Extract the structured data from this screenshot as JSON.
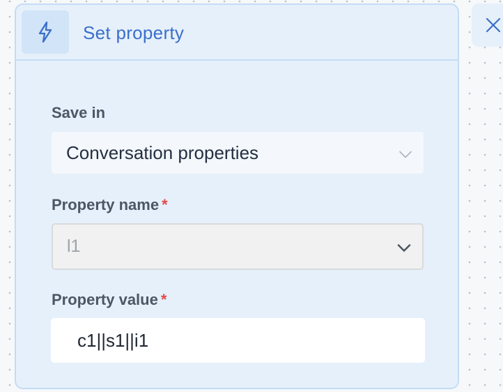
{
  "panel": {
    "title": "Set property",
    "icon": "lightning-icon"
  },
  "fields": {
    "save_in": {
      "label": "Save in",
      "value": "Conversation properties"
    },
    "property_name": {
      "label": "Property name",
      "required_mark": "*",
      "value": "l1"
    },
    "property_value": {
      "label": "Property value",
      "required_mark": "*",
      "value": "c1||s1||i1"
    }
  },
  "close": {
    "icon": "close-icon"
  },
  "colors": {
    "accent": "#3a6fc9",
    "panel_background": "#e6f0fb",
    "panel_border": "#c4dcf5",
    "required": "#e24a4a"
  }
}
